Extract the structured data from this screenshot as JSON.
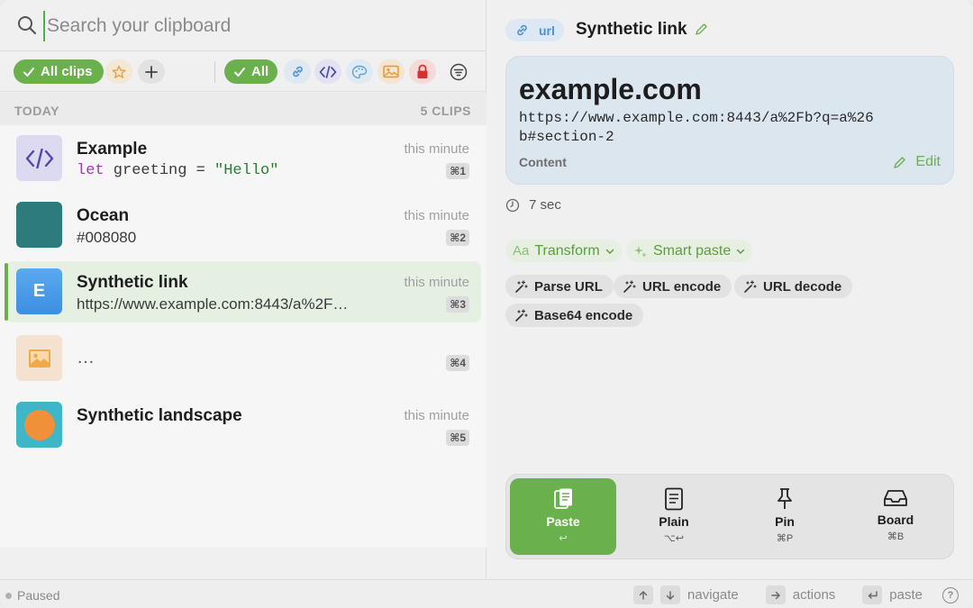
{
  "search": {
    "placeholder": "Search your clipboard"
  },
  "filters": {
    "all_clips": "All clips",
    "all_types": "All"
  },
  "list": {
    "section": "TODAY",
    "count": "5 CLIPS",
    "clips": [
      {
        "title": "Example",
        "code_keyword": "let",
        "code_rest": " greeting = ",
        "code_string": "\"Hello\"",
        "time": "this minute",
        "shortcut": "⌘1"
      },
      {
        "title": "Ocean",
        "subtitle": "#008080",
        "time": "this minute",
        "shortcut": "⌘2",
        "swatch_color": "#2e7b7b"
      },
      {
        "title": "Synthetic link",
        "subtitle": "https://www.example.com:8443/a%2F…",
        "thumb_letter": "E",
        "time": "this minute",
        "shortcut": "⌘3"
      },
      {
        "title": "",
        "subtitle": "…",
        "time": "",
        "shortcut": "⌘4"
      },
      {
        "title": "Synthetic landscape",
        "time": "this minute",
        "shortcut": "⌘5"
      }
    ]
  },
  "detail": {
    "type": "url",
    "title": "Synthetic link",
    "domain": "example.com",
    "url": "https://www.example.com:8443/a%2Fb?q=a%26b#section-2",
    "content_label": "Content",
    "edit_label": "Edit",
    "age": "7 sec",
    "transform_label": "Transform",
    "smart_paste_label": "Smart paste",
    "actions": [
      "Parse URL",
      "URL encode",
      "URL decode",
      "Base64 encode"
    ]
  },
  "action_bar": {
    "paste": {
      "label": "Paste",
      "key": "↩"
    },
    "plain": {
      "label": "Plain",
      "key": "⌥↩"
    },
    "pin": {
      "label": "Pin",
      "key": "⌘P"
    },
    "board": {
      "label": "Board",
      "key": "⌘B"
    }
  },
  "status": {
    "state": "Paused",
    "navigate": "navigate",
    "actions": "actions",
    "paste": "paste",
    "help": "?"
  },
  "colors": {
    "accent": "#6ab04c",
    "link_blue": "#4a90d9"
  }
}
